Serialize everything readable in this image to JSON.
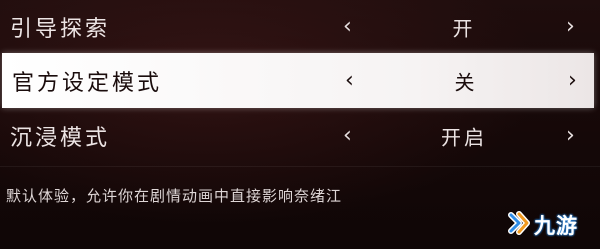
{
  "settings": [
    {
      "label": "引导探索",
      "value": "开",
      "selected": false
    },
    {
      "label": "官方设定模式",
      "value": "关",
      "selected": true
    },
    {
      "label": "沉浸模式",
      "value": "开启",
      "selected": false
    }
  ],
  "arrows": {
    "left": "‹",
    "right": "›"
  },
  "description": "默认体验，允许你在剧情动画中直接影响奈绪江",
  "watermark": {
    "text": "九游",
    "icon": "jiuyou-logo-icon",
    "color": "#2d8ce8"
  },
  "colors": {
    "selected_row_bg": "#ffffff",
    "background": "#150808",
    "text": "#ece4e4"
  }
}
